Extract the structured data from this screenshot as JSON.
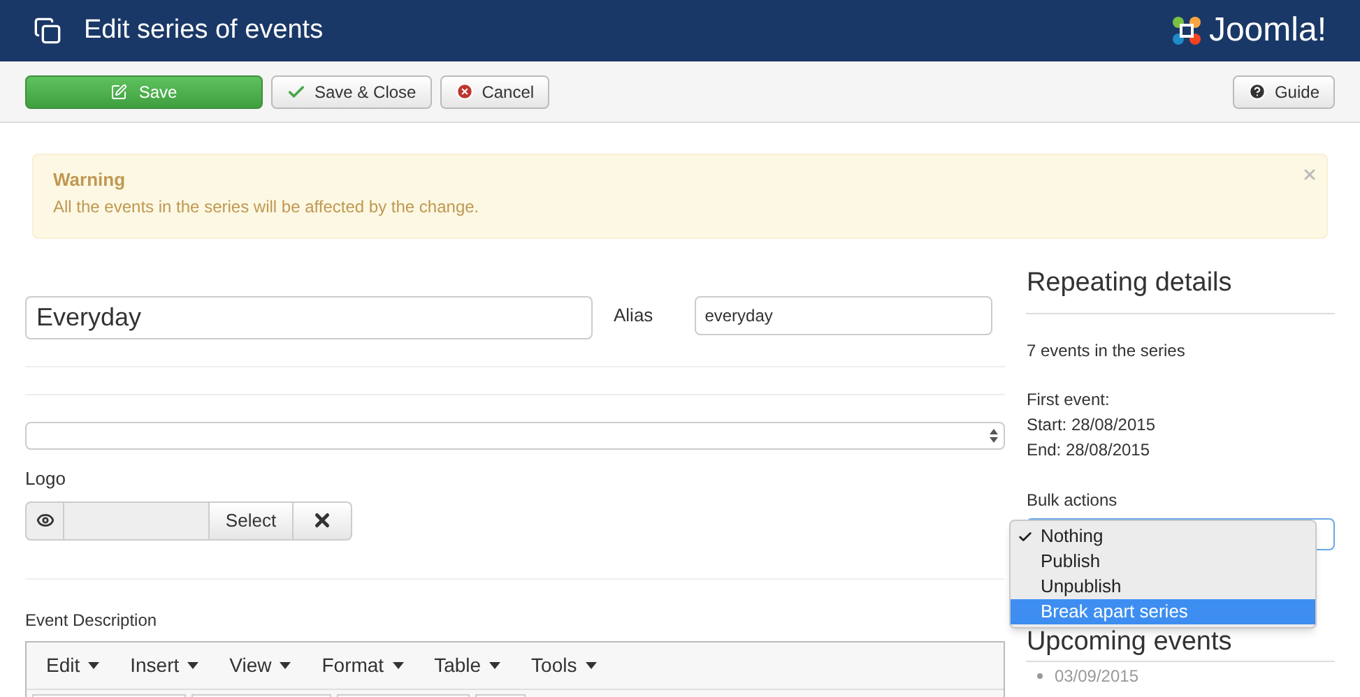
{
  "header": {
    "title": "Edit series of events",
    "logo_text": "Joomla!"
  },
  "toolbar": {
    "buttons": [
      {
        "label": "Save",
        "kind": "primary"
      },
      {
        "label": "Save & Close",
        "kind": "check"
      },
      {
        "label": "Cancel",
        "kind": "cancel"
      }
    ],
    "help": {
      "label": "Guide"
    }
  },
  "warning": {
    "heading": "Warning",
    "message": "All the events in the series will be affected by the change."
  },
  "form": {
    "title_value": "Everyday",
    "alias_label": "Alias",
    "alias_value": "everyday",
    "logo_label": "Logo",
    "select_button": "Select",
    "description_label": "Event Description",
    "editor_menu": [
      "Edit",
      "Insert",
      "View",
      "Format",
      "Table",
      "Tools"
    ]
  },
  "sidebar": {
    "heading": "Repeating details",
    "count": "7 events in the series",
    "first_event_label": "First event:",
    "start": "Start: 28/08/2015",
    "end": "End: 28/08/2015",
    "bulk_label": "Bulk actions",
    "bulk_options": [
      {
        "label": "Nothing",
        "selected": true,
        "highlighted": false
      },
      {
        "label": "Publish",
        "selected": false,
        "highlighted": false
      },
      {
        "label": "Unpublish",
        "selected": false,
        "highlighted": false
      },
      {
        "label": "Break apart series",
        "selected": false,
        "highlighted": true
      }
    ],
    "upcoming_heading": "Upcoming events",
    "upcoming": [
      "03/09/2015"
    ]
  }
}
